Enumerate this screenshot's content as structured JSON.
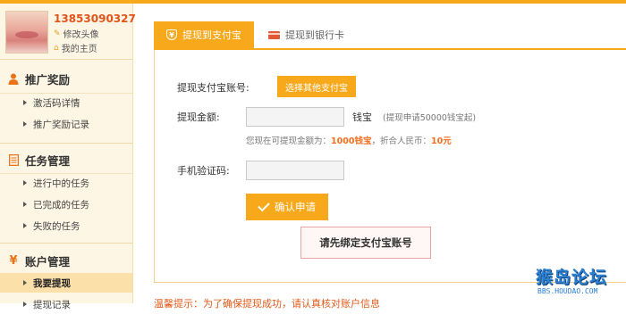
{
  "profile": {
    "phone": "13853090327",
    "edit_avatar": "修改头像",
    "homepage": "我的主页"
  },
  "sidebar": {
    "sections": [
      {
        "title": "推广奖励",
        "icon": "person-icon",
        "items": [
          {
            "label": "激活码详情"
          },
          {
            "label": "推广奖励记录"
          }
        ]
      },
      {
        "title": "任务管理",
        "icon": "document-icon",
        "items": [
          {
            "label": "进行中的任务"
          },
          {
            "label": "已完成的任务"
          },
          {
            "label": "失败的任务"
          }
        ]
      },
      {
        "title": "账户管理",
        "icon": "money-icon",
        "items": [
          {
            "label": "我要提现",
            "active": true
          },
          {
            "label": "提现记录"
          }
        ]
      }
    ]
  },
  "tabs": [
    {
      "label": "提现到支付宝",
      "active": true,
      "icon": "shield-icon"
    },
    {
      "label": "提现到银行卡",
      "active": false,
      "icon": "bank-card-icon"
    }
  ],
  "form": {
    "alipay_label": "提现支付宝账号:",
    "select_alipay_button": "选择其他支付宝",
    "amount_label": "提现金额:",
    "amount_value": "",
    "amount_unit": "钱宝",
    "amount_hint": "(提现申请50000钱宝起)",
    "note_prefix": "您现在可提现金额为：",
    "note_amount": "1000钱宝",
    "note_middle": "，折合人民币：",
    "note_rmb": "10元",
    "phone_code_label": "手机验证码:",
    "phone_code_value": "",
    "confirm_button": "确认申请",
    "warning": "请先绑定支付宝账号"
  },
  "footer_note": "温馨提示：为了确保提现成功，请认真核对账户信息",
  "watermark": {
    "main": "猴岛论坛",
    "sub": "BBS.HOUDAO.COM"
  },
  "colors": {
    "accent": "#f7a81b",
    "highlight": "#f36f1f",
    "sidebar_bg": "#fdf6e4"
  }
}
